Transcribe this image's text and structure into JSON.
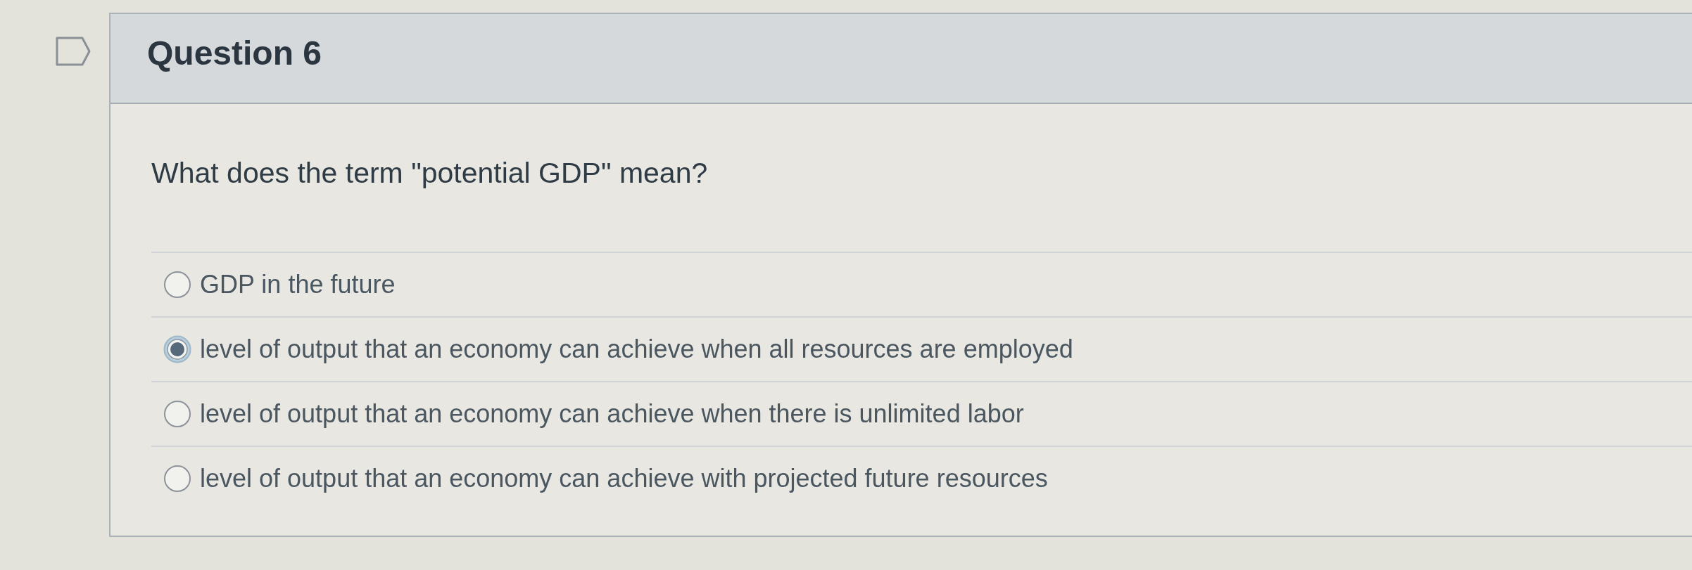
{
  "question": {
    "flagged": false,
    "title": "Question 6",
    "prompt": "What does the term \"potential GDP\" mean?",
    "answers": [
      {
        "label": "GDP in the future",
        "selected": false
      },
      {
        "label": "level of output that an economy can achieve when all resources are employed",
        "selected": true
      },
      {
        "label": "level of output that an economy can achieve when there is unlimited labor",
        "selected": false
      },
      {
        "label": "level of output that an economy can achieve with projected future resources",
        "selected": false
      }
    ]
  }
}
